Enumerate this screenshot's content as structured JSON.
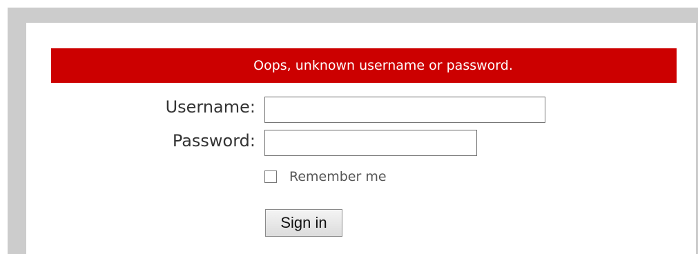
{
  "error_message": "Oops, unknown username or password.",
  "form": {
    "username_label": "Username:",
    "username_value": "",
    "password_label": "Password:",
    "password_value": "",
    "remember_label": "Remember me",
    "remember_checked": false,
    "signin_label": "Sign in"
  },
  "colors": {
    "error_banner": "#cc0000",
    "frame": "#cccccc"
  }
}
